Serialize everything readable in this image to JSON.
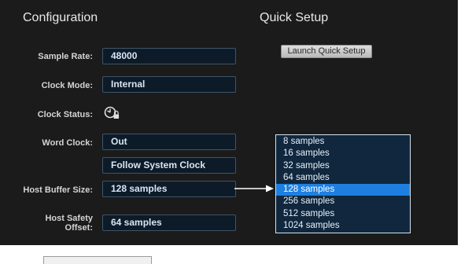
{
  "headers": {
    "configuration": "Configuration",
    "quick_setup": "Quick Setup"
  },
  "fields": {
    "sample_rate": {
      "label": "Sample Rate:",
      "value": "48000"
    },
    "clock_mode": {
      "label": "Clock Mode:",
      "value": "Internal"
    },
    "clock_status": {
      "label": "Clock Status:",
      "icon": "clock-lock-icon"
    },
    "word_clock": {
      "label": "Word Clock:",
      "value": "Out"
    },
    "follow_system_clock": {
      "value": "Follow System Clock"
    },
    "host_buffer_size": {
      "label": "Host Buffer Size:",
      "value": "128 samples"
    },
    "host_safety_offset": {
      "label_line1": "Host Safety",
      "label_line2": "Offset:",
      "value": "64 samples"
    }
  },
  "quick_setup": {
    "button_label": "Launch Quick Setup"
  },
  "buffer_dropdown": {
    "options": [
      "8 samples",
      "16 samples",
      "32 samples",
      "64 samples",
      "128 samples",
      "256 samples",
      "512 samples",
      "1024 samples"
    ],
    "selected": "128 samples"
  },
  "colors": {
    "panel_bg": "#1b1b1b",
    "field_bg": "#0d1b28",
    "selection": "#1e7fe0"
  }
}
